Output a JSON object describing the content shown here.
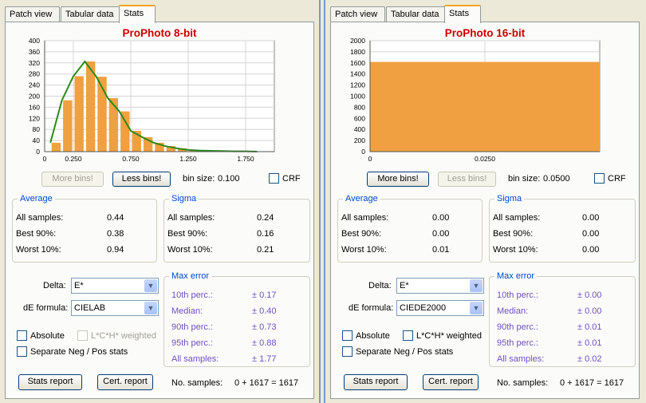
{
  "panels": [
    {
      "tabs": [
        "Patch view",
        "Tabular data",
        "Stats"
      ],
      "active_tab": 2,
      "chart_title": "ProPhoto 8-bit",
      "buttons": {
        "more_bins": "More bins!",
        "less_bins": "Less bins!",
        "more_enabled": false,
        "less_enabled": true
      },
      "bin_size_label": "bin size:",
      "bin_size_value": "0.100",
      "crf_label": "CRF",
      "average": {
        "title": "Average",
        "rows": [
          {
            "label": "All samples:",
            "value": "0.44"
          },
          {
            "label": "Best 90%:",
            "value": "0.38"
          },
          {
            "label": "Worst 10%:",
            "value": "0.94"
          }
        ]
      },
      "sigma": {
        "title": "Sigma",
        "rows": [
          {
            "label": "All samples:",
            "value": "0.24"
          },
          {
            "label": "Best 90%:",
            "value": "0.16"
          },
          {
            "label": "Worst 10%:",
            "value": "0.21"
          }
        ]
      },
      "delta_label": "Delta:",
      "delta_value": "E*",
      "formula_label": "dE formula:",
      "formula_value": "CIELAB",
      "absolute_label": "Absolute",
      "weighted_label": "L*C*H* weighted",
      "weighted_enabled": false,
      "separate_label": "Separate Neg / Pos stats",
      "max_error": {
        "title": "Max error",
        "rows": [
          {
            "label": "10th perc.:",
            "value": "± 0.17"
          },
          {
            "label": "Median:",
            "value": "± 0.40"
          },
          {
            "label": "90th perc.:",
            "value": "± 0.73"
          },
          {
            "label": "95th perc.:",
            "value": "± 0.88"
          },
          {
            "label": "All samples:",
            "value": "± 1.77"
          }
        ]
      },
      "stats_report": "Stats report",
      "cert_report": "Cert. report",
      "no_samples_label": "No. samples:",
      "no_samples_value": "0 + 1617 = 1617"
    },
    {
      "tabs": [
        "Patch view",
        "Tabular data",
        "Stats"
      ],
      "active_tab": 2,
      "chart_title": "ProPhoto 16-bit",
      "buttons": {
        "more_bins": "More bins!",
        "less_bins": "Less bins!",
        "more_enabled": true,
        "less_enabled": false
      },
      "bin_size_label": "bin size:",
      "bin_size_value": "0.0500",
      "crf_label": "CRF",
      "average": {
        "title": "Average",
        "rows": [
          {
            "label": "All samples:",
            "value": "0.00"
          },
          {
            "label": "Best 90%:",
            "value": "0.00"
          },
          {
            "label": "Worst 10%:",
            "value": "0.01"
          }
        ]
      },
      "sigma": {
        "title": "Sigma",
        "rows": [
          {
            "label": "All samples:",
            "value": "0.00"
          },
          {
            "label": "Best 90%:",
            "value": "0.00"
          },
          {
            "label": "Worst 10%:",
            "value": "0.00"
          }
        ]
      },
      "delta_label": "Delta:",
      "delta_value": "E*",
      "formula_label": "dE formula:",
      "formula_value": "CIEDE2000",
      "absolute_label": "Absolute",
      "weighted_label": "L*C*H* weighted",
      "weighted_enabled": true,
      "separate_label": "Separate Neg / Pos stats",
      "max_error": {
        "title": "Max error",
        "rows": [
          {
            "label": "10th perc.:",
            "value": "± 0.00"
          },
          {
            "label": "Median:",
            "value": "± 0.00"
          },
          {
            "label": "90th perc.:",
            "value": "± 0.01"
          },
          {
            "label": "95th perc.:",
            "value": "± 0.01"
          },
          {
            "label": "All samples:",
            "value": "± 0.02"
          }
        ]
      },
      "stats_report": "Stats report",
      "cert_report": "Cert. report",
      "no_samples_label": "No. samples:",
      "no_samples_value": "0 + 1617 = 1617"
    }
  ],
  "chart_data": [
    {
      "type": "bar",
      "title": "ProPhoto 8-bit",
      "xlim": [
        0,
        2.0
      ],
      "ylim": [
        0,
        400
      ],
      "yticks": [
        0,
        40,
        80,
        120,
        160,
        200,
        240,
        280,
        320,
        360,
        400
      ],
      "xticks": [
        0,
        0.25,
        0.75,
        1.25,
        1.75
      ],
      "xtick_labels": [
        "0",
        "0.250",
        "0.750",
        "1.250",
        "1.750"
      ],
      "bin_width": 0.1,
      "bar_color": "#f0a040",
      "bins_start": [
        0.05,
        0.15,
        0.25,
        0.35,
        0.45,
        0.55,
        0.65,
        0.75,
        0.85,
        0.95,
        1.05,
        1.15,
        1.25,
        1.35,
        1.45,
        1.55,
        1.65,
        1.75
      ],
      "values": [
        32,
        185,
        272,
        325,
        270,
        193,
        145,
        75,
        52,
        32,
        20,
        12,
        6,
        4,
        3,
        2,
        1,
        1
      ],
      "crf_line": {
        "color": "#2a8a1a",
        "x": [
          0.05,
          0.15,
          0.25,
          0.35,
          0.45,
          0.55,
          0.65,
          0.75,
          0.85,
          0.95,
          1.05,
          1.15,
          1.25,
          1.35,
          1.45,
          1.55,
          1.65,
          1.75,
          1.85
        ],
        "y": [
          32,
          185,
          272,
          325,
          270,
          193,
          145,
          75,
          52,
          32,
          20,
          12,
          6,
          4,
          3,
          2,
          1,
          1,
          0
        ]
      }
    },
    {
      "type": "bar",
      "title": "ProPhoto 16-bit",
      "xlim": [
        0,
        0.05
      ],
      "ylim": [
        0,
        2000
      ],
      "yticks": [
        0,
        200,
        400,
        600,
        800,
        1000,
        1200,
        1400,
        1600,
        1800,
        2000
      ],
      "xticks": [
        0,
        0.025
      ],
      "xtick_labels": [
        "0",
        "0.0250"
      ],
      "bin_width": 0.05,
      "bar_color": "#f0a040",
      "bins_start": [
        0
      ],
      "values": [
        1617
      ]
    }
  ]
}
